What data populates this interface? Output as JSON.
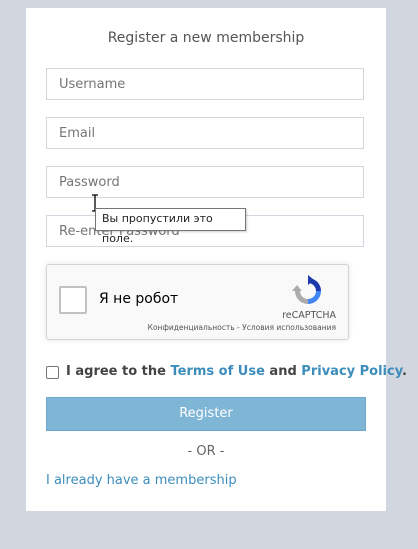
{
  "form": {
    "title": "Register a new membership",
    "username_placeholder": "Username",
    "email_placeholder": "Email",
    "password_placeholder": "Password",
    "reenter_placeholder": "Re-enter Password"
  },
  "validation_tooltip": "Вы пропустили это поле.",
  "recaptcha": {
    "label": "Я не робот",
    "brand": "reCAPTCHA",
    "privacy_link": "Конфиденциальность",
    "separator": " - ",
    "terms_link": "Условия использования",
    "icon": "recaptcha-logo-icon"
  },
  "agreement": {
    "prefix": "I agree to the ",
    "terms_link": "Terms of Use",
    "middle": " and ",
    "privacy_link": "Privacy Policy",
    "suffix": "."
  },
  "register_button": "Register",
  "separator_text": "- OR -",
  "login_link": "I already have a membership",
  "colors": {
    "background": "#d2d6de",
    "accent": "#3c8dbc",
    "button": "#7fb5d5"
  }
}
